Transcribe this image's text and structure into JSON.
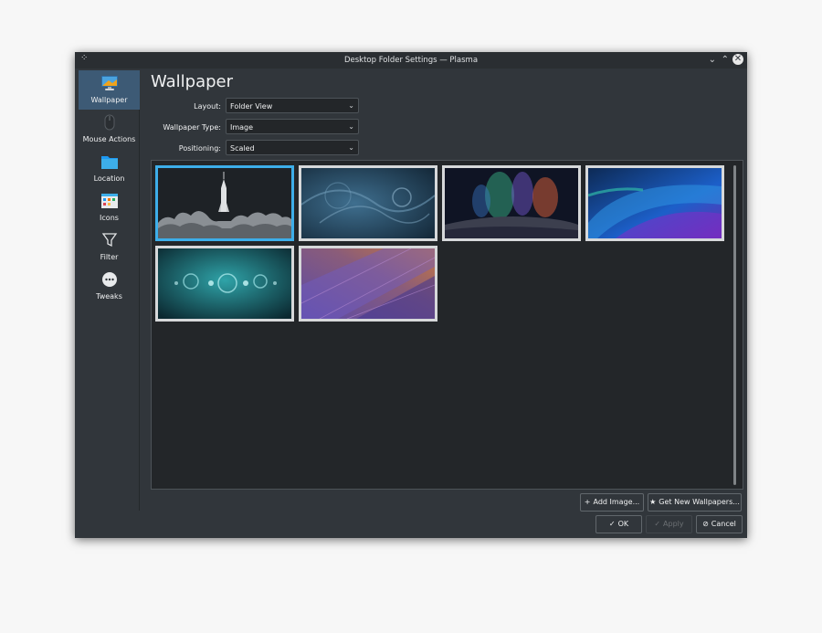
{
  "window": {
    "title": "Desktop Folder Settings — Plasma",
    "minimize_glyph": "⌄",
    "maximize_glyph": "⌃",
    "close_glyph": "✕"
  },
  "sidebar": {
    "items": [
      {
        "label": "Wallpaper",
        "icon": "monitor-icon",
        "active": true
      },
      {
        "label": "Mouse Actions",
        "icon": "mouse-icon",
        "active": false
      },
      {
        "label": "Location",
        "icon": "folder-icon",
        "active": false
      },
      {
        "label": "Icons",
        "icon": "icons-grid-icon",
        "active": false
      },
      {
        "label": "Filter",
        "icon": "funnel-icon",
        "active": false
      },
      {
        "label": "Tweaks",
        "icon": "more-dots-icon",
        "active": false
      }
    ]
  },
  "main": {
    "heading": "Wallpaper",
    "layout": {
      "label": "Layout:",
      "value": "Folder View"
    },
    "wallpaper_type": {
      "label": "Wallpaper Type:",
      "value": "Image"
    },
    "positioning": {
      "label": "Positioning:",
      "value": "Scaled"
    }
  },
  "gallery": {
    "wallpapers": [
      {
        "name": "rocket-launch",
        "selected": true
      },
      {
        "name": "blue-swirls",
        "selected": false
      },
      {
        "name": "aurora-hills",
        "selected": false
      },
      {
        "name": "blue-purple-waves",
        "selected": false
      },
      {
        "name": "teal-bubbles",
        "selected": false
      },
      {
        "name": "geometric-purple-orange",
        "selected": false
      }
    ]
  },
  "buttons": {
    "add_image": "Add Image...",
    "get_new": "Get New Wallpapers...",
    "ok": "OK",
    "apply": "Apply",
    "cancel": "Cancel"
  },
  "colors": {
    "window_bg": "#31363b",
    "accent": "#3daee9",
    "sidebar_active": "#3d5a75"
  }
}
